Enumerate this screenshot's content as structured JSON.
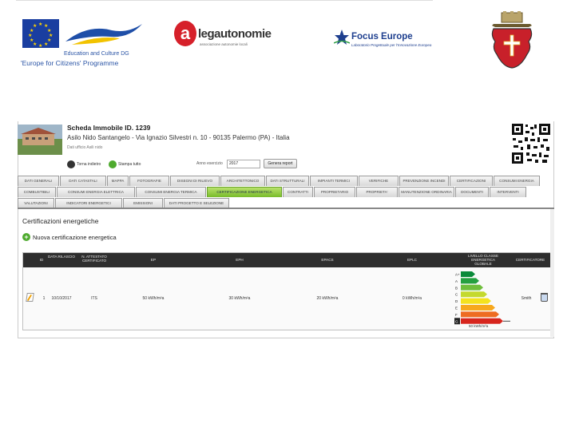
{
  "header": {
    "eu_dg": "Education and Culture DG",
    "eu_programme": "'Europe for Citizens' Programme",
    "legautonomie_name": "legautonomie",
    "legautonomie_tagline": "associazione autonomie locali",
    "focus_name": "Focus Europe",
    "focus_tagline": "Laboratorio Progettuale per l'Innovazione Europea",
    "colors": {
      "eu_blue": "#1a3ea0",
      "eu_star": "#ffd400",
      "lega_red": "#d6202a",
      "focus_blue": "#1e3f8f",
      "crest_red": "#c8202a"
    },
    "icons": [
      "eu-flag-icon",
      "eu-bird-icon",
      "legautonomie-logo",
      "focus-europe-star-icon",
      "palermo-crest-icon"
    ]
  },
  "app": {
    "title": "Scheda Immobile ID. 1239",
    "address": "Asilo Nido Santangelo - Via Ignazio Silvestri n. 10 - 90135 Palermo (PA) - Italia",
    "note": "Dati ufficio Asili nido",
    "actions": {
      "back_label": "Torna indietro",
      "print_label": "Stampa tutto",
      "year_label": "Anno esercizio",
      "year_value": "2017",
      "generate_label": "Genera report"
    },
    "tabs_row1": [
      "DATI GENERALI",
      "DATI CATASTALI",
      "MAPPA",
      "FOTOGRAFIE",
      "DISEGNI DI RILIEVO",
      "ARCHITETTONICO",
      "DATI STRUTTURALI",
      "IMPIANTI TERMICI",
      "VERIFICHE",
      "PREVENZIONE INCENDI",
      "CERTIFICAZIONI",
      "CONSUMI ENERGIA"
    ],
    "tabs_row2": [
      "COMBUSTIBILI",
      "CONSUMI ENERGIA ELETTRICA",
      "CONSUMI ENERGIA TERMICA",
      "CERTIFICAZIONE ENERGETICA",
      "CONTRATTI",
      "PROPRIETARIO",
      "PROPRIETA'",
      "MANUTENZIONE ORDINARIA",
      "DOCUMENTI",
      "INTERVENTI"
    ],
    "tabs_row3": [
      "VALUTAZIONI",
      "INDICATORI ENERGETICI",
      "EMISSIONI",
      "DATI PROGETTO E SELEZIONE"
    ],
    "active_tab": "CERTIFICAZIONE ENERGETICA",
    "section_title": "Certificazioni energetiche",
    "new_label": "Nuova certificazione energetica",
    "table": {
      "columns": [
        "ID",
        "DATA RILASCIO",
        "N. ATTESTATO CERTIFICATO",
        "EP",
        "EPH",
        "EPACS",
        "EPLC",
        "LIVELLO CLASSE ENERGETICA GLOBALE",
        "CERTIFICATORE"
      ],
      "row": {
        "id": "1",
        "date": "10/10/2017",
        "number": "ITS",
        "ep": "50 kWh/m²a",
        "eph": "30 kWh/m²a",
        "epacs": "20 kWh/m²a",
        "eplc": "0 kWh/m²a",
        "energy_value": "50 kWh/m²a",
        "energy_class": "G",
        "certifier": "Smith"
      },
      "energy_classes": [
        "A+",
        "A",
        "B",
        "C",
        "D",
        "E",
        "F",
        "G"
      ],
      "energy_colors": [
        "#0a8a3a",
        "#25a040",
        "#6fbe3c",
        "#c4d92e",
        "#f4e21e",
        "#f7a81d",
        "#ee6c22",
        "#d7261e"
      ]
    }
  }
}
